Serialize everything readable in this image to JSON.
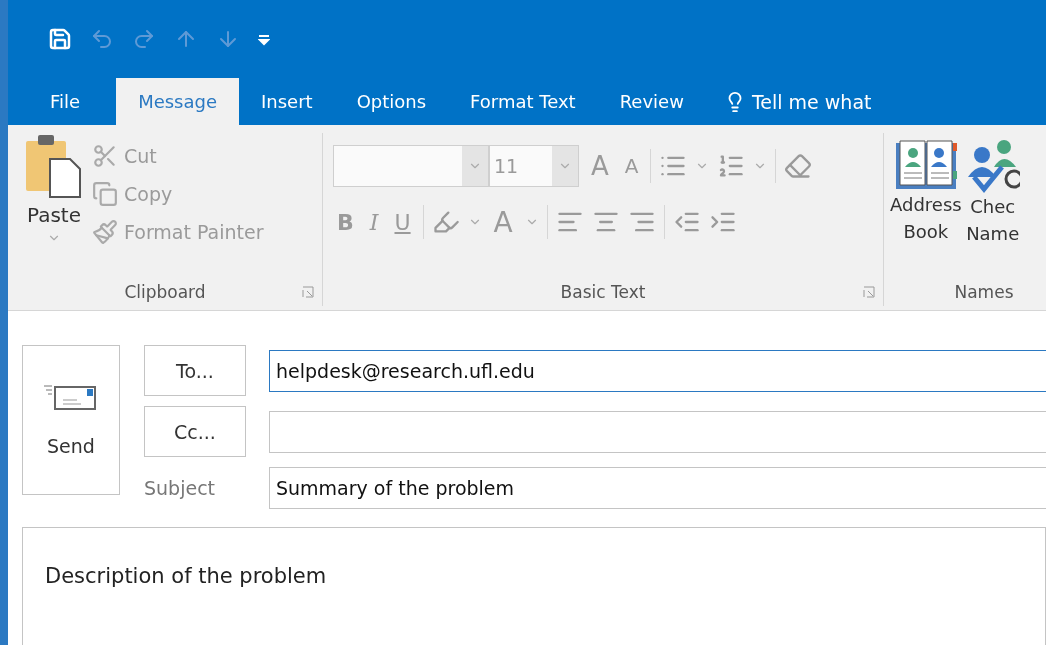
{
  "quick_access": [
    {
      "kind": "save",
      "disabled": false
    },
    {
      "kind": "undo",
      "disabled": true
    },
    {
      "kind": "redo",
      "disabled": true
    },
    {
      "kind": "up",
      "disabled": true
    },
    {
      "kind": "down",
      "disabled": true
    },
    {
      "kind": "more",
      "disabled": false
    }
  ],
  "tabs": [
    {
      "label": "File",
      "selected": false
    },
    {
      "label": "Message",
      "selected": true
    },
    {
      "label": "Insert",
      "selected": false
    },
    {
      "label": "Options",
      "selected": false
    },
    {
      "label": "Format Text",
      "selected": false
    },
    {
      "label": "Review",
      "selected": false
    }
  ],
  "tell_me": "Tell me what",
  "clipboard": {
    "label": "Clipboard",
    "paste": "Paste",
    "items": [
      {
        "kind": "cut",
        "label": "Cut",
        "disabled": true
      },
      {
        "kind": "copy",
        "label": "Copy",
        "disabled": true
      },
      {
        "kind": "painter",
        "label": "Format Painter",
        "disabled": true
      }
    ]
  },
  "basic_text": {
    "label": "Basic Text",
    "disabled": true,
    "font_size": "11",
    "grow": "A",
    "shrink": "A",
    "bold": "B",
    "italic": "I",
    "underline": "U",
    "font_color": "A"
  },
  "names": {
    "label": "Names",
    "buttons": [
      {
        "kind": "address",
        "lines": [
          "Address",
          "Book"
        ]
      },
      {
        "kind": "check",
        "lines": [
          "Chec",
          "Name"
        ]
      }
    ]
  },
  "compose": {
    "send": "Send",
    "to_button": "To...",
    "cc_button": "Cc...",
    "subject_label": "Subject",
    "to_value": "helpdesk@research.ufl.edu",
    "to_focused": true,
    "subject_value": "Summary of the problem",
    "body": "Description of the problem"
  }
}
